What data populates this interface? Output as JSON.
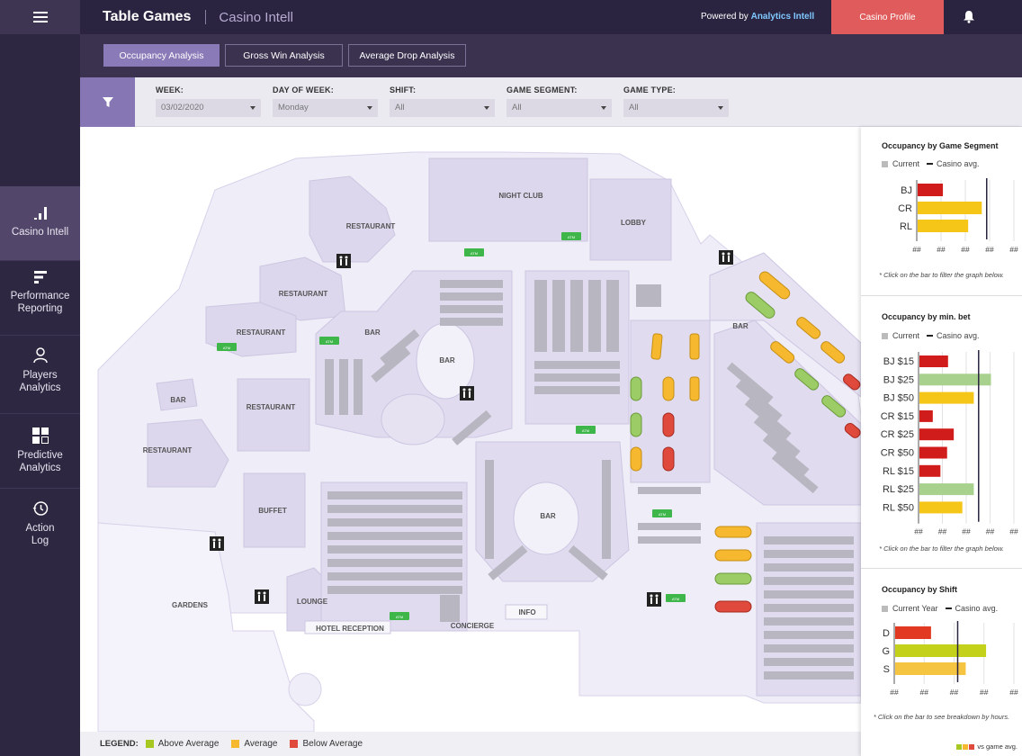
{
  "header": {
    "title": "Table Games",
    "subtitle": "Casino Intell",
    "powered_prefix": "Powered by",
    "powered_brand": "Analytics Intell",
    "profile_button": "Casino Profile"
  },
  "sidebar": {
    "items": [
      {
        "label": "Casino Intell",
        "icon": "bar-chart-icon",
        "active": true
      },
      {
        "label": "Performance Reporting",
        "icon": "bars-icon"
      },
      {
        "label": "Players Analytics",
        "icon": "user-icon"
      },
      {
        "label": "Predictive Analytics",
        "icon": "grid-icon"
      },
      {
        "label": "Action Log",
        "icon": "history-icon"
      }
    ]
  },
  "tabs": [
    {
      "label": "Occupancy Analysis",
      "active": true
    },
    {
      "label": "Gross Win Analysis"
    },
    {
      "label": "Average Drop Analysis"
    }
  ],
  "filters": [
    {
      "label": "WEEK:",
      "value": "03/02/2020"
    },
    {
      "label": "DAY OF WEEK:",
      "value": "Monday"
    },
    {
      "label": "SHIFT:",
      "value": "All"
    },
    {
      "label": "GAME SEGMENT:",
      "value": "All"
    },
    {
      "label": "GAME TYPE:",
      "value": "All"
    }
  ],
  "map_labels": {
    "night_club": "NIGHT CLUB",
    "lobby": "LOBBY",
    "restaurant": "RESTAURANT",
    "bar": "BAR",
    "buffet": "BUFFET",
    "gardens": "GARDENS",
    "lounge": "LOUNGE",
    "hotel_reception": "HOTEL RECEPTION",
    "concierge": "CONCIERGE",
    "info": "INFO",
    "atm": "ATM"
  },
  "legend": {
    "title": "LEGEND:",
    "items": [
      {
        "label": "Above Average",
        "color": "#a6c820"
      },
      {
        "label": "Average",
        "color": "#f5b82e"
      },
      {
        "label": "Below Average",
        "color": "#e04a3c"
      }
    ],
    "footnote": "vs game avg."
  },
  "colors": {
    "above": "#a6c820",
    "average": "#f5b82e",
    "below": "#e04a3c",
    "accent": "#8676b3",
    "map_fill": "#dcd7ec"
  },
  "chart_data": [
    {
      "type": "bar",
      "title": "Occupancy by Game Segment",
      "legend": [
        "Current",
        "Casino avg."
      ],
      "categories": [
        "BJ",
        "CR",
        "RL"
      ],
      "values": [
        0.26,
        0.66,
        0.52
      ],
      "colors": [
        "#d11c1c",
        "#f5c518",
        "#f5c518"
      ],
      "avg": 0.72,
      "tick_label": "##",
      "ticks": 5,
      "note": "* Click on the bar to filter the graph below."
    },
    {
      "type": "bar",
      "title": "Occupancy by min. bet",
      "legend": [
        "Current",
        "Casino avg."
      ],
      "categories": [
        "BJ $15",
        "BJ $25",
        "BJ $50",
        "CR $15",
        "CR $25",
        "CR $50",
        "RL $15",
        "RL $25",
        "RL $50"
      ],
      "values": [
        0.3,
        0.75,
        0.57,
        0.14,
        0.36,
        0.29,
        0.22,
        0.57,
        0.45
      ],
      "colors": [
        "#d11c1c",
        "#a9d18e",
        "#f5c518",
        "#d11c1c",
        "#d11c1c",
        "#d11c1c",
        "#d11c1c",
        "#a9d18e",
        "#f5c518"
      ],
      "avg": 0.63,
      "tick_label": "##",
      "ticks": 5,
      "note": "* Click on the bar to filter the graph below."
    },
    {
      "type": "bar",
      "title": "Occupancy by Shift",
      "legend": [
        "Current Year",
        "Casino avg."
      ],
      "categories": [
        "D",
        "G",
        "S"
      ],
      "values": [
        0.3,
        0.76,
        0.59
      ],
      "colors": [
        "#e23a22",
        "#c4d11a",
        "#f5c542"
      ],
      "avg": 0.53,
      "tick_label": "##",
      "ticks": 5,
      "note": "* Click on the bar to see breakdown by hours."
    }
  ]
}
